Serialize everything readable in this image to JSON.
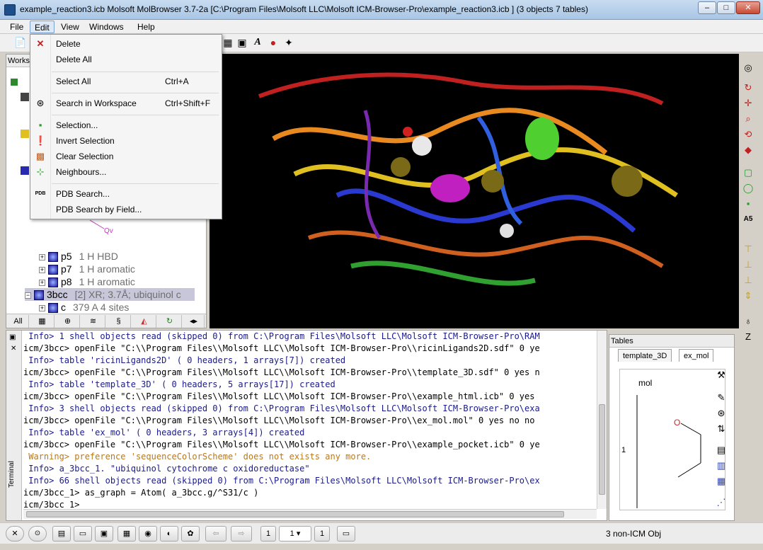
{
  "window": {
    "title": "example_reaction3.icb  Molsoft MolBrowser 3.7-2a  [C:\\Program Files\\Molsoft LLC\\Molsoft ICM-Browser-Pro\\example_reaction3.icb ] (3 objects 7 tables)",
    "minimize": "–",
    "maximize": "□",
    "close": "✕"
  },
  "menubar": [
    "File",
    "Edit",
    "View",
    "Windows",
    "Help"
  ],
  "edit_menu": [
    {
      "label": "Delete",
      "shortcut": "",
      "icon": "delete-icon"
    },
    {
      "label": "Delete All",
      "shortcut": "",
      "icon": ""
    },
    {
      "label": "Select All",
      "shortcut": "Ctrl+A",
      "icon": ""
    },
    {
      "label": "Search in Workspace",
      "shortcut": "Ctrl+Shift+F",
      "icon": "binoculars-icon"
    },
    {
      "label": "Selection...",
      "shortcut": "",
      "icon": "selection-icon"
    },
    {
      "label": "Invert Selection",
      "shortcut": "",
      "icon": "invert-selection-icon"
    },
    {
      "label": "Clear Selection",
      "shortcut": "",
      "icon": "clear-selection-icon"
    },
    {
      "label": "Neighbours...",
      "shortcut": "",
      "icon": "neighbours-icon"
    },
    {
      "label": "PDB Search...",
      "shortcut": "",
      "icon": "pdb-icon"
    },
    {
      "label": "PDB Search by Field...",
      "shortcut": "",
      "icon": ""
    }
  ],
  "workspace": {
    "tab": "Works",
    "tree": [
      {
        "name": "p5",
        "desc": "1 H HBD"
      },
      {
        "name": "p7",
        "desc": "1 H aromatic"
      },
      {
        "name": "p8",
        "desc": "1 H aromatic"
      },
      {
        "name": "3bcc",
        "desc": "[2] XR; 3.7Å; ubiquinol c"
      },
      {
        "name": "c",
        "desc": "379 A  4 sites"
      }
    ],
    "molecule_label": "Qv",
    "bottom_tabs": [
      "All"
    ]
  },
  "terminal": {
    "label": "Terminal",
    "lines": [
      {
        "kind": "info",
        "text": " Info> 1 shell objects read (skipped 0) from C:\\Program Files\\Molsoft LLC\\Molsoft ICM-Browser-Pro\\RAM"
      },
      {
        "kind": "cmd",
        "text": "icm/3bcc> openFile \"C:\\\\Program Files\\\\Molsoft LLC\\\\Molsoft ICM-Browser-Pro\\\\ricinLigands2D.sdf\" 0 ye"
      },
      {
        "kind": "info",
        "text": " Info> table 'ricinLigands2D' ( 0 headers, 1 arrays[7]) created"
      },
      {
        "kind": "cmd",
        "text": "icm/3bcc> openFile \"C:\\\\Program Files\\\\Molsoft LLC\\\\Molsoft ICM-Browser-Pro\\\\template_3D.sdf\" 0 yes n"
      },
      {
        "kind": "info",
        "text": " Info> table 'template_3D' ( 0 headers, 5 arrays[17]) created"
      },
      {
        "kind": "cmd",
        "text": "icm/3bcc> openFile \"C:\\\\Program Files\\\\Molsoft LLC\\\\Molsoft ICM-Browser-Pro\\\\example_html.icb\" 0 yes"
      },
      {
        "kind": "info",
        "text": " Info> 3 shell objects read (skipped 0) from C:\\Program Files\\Molsoft LLC\\Molsoft ICM-Browser-Pro\\exa"
      },
      {
        "kind": "cmd",
        "text": "icm/3bcc> openFile \"C:\\\\Program Files\\\\Molsoft LLC\\\\Molsoft ICM-Browser-Pro\\\\ex_mol.mol\" 0 yes no no"
      },
      {
        "kind": "info",
        "text": " Info> table 'ex_mol' ( 0 headers, 3 arrays[4]) created"
      },
      {
        "kind": "cmd",
        "text": "icm/3bcc> openFile \"C:\\\\Program Files\\\\Molsoft LLC\\\\Molsoft ICM-Browser-Pro\\\\example_pocket.icb\" 0 ye"
      },
      {
        "kind": "warn",
        "text": " Warning> preference 'sequenceColorScheme' does not exists any more."
      },
      {
        "kind": "info",
        "text": " Info> a_3bcc_1. \"ubiquinol cytochrome c oxidoreductase\""
      },
      {
        "kind": "info",
        "text": " Info> 66 shell objects read (skipped 0) from C:\\Program Files\\Molsoft LLC\\Molsoft ICM-Browser-Pro\\ex"
      },
      {
        "kind": "cmd",
        "text": "icm/3bcc_1> as_graph = Atom( a_3bcc.g/^S31/c )"
      },
      {
        "kind": "cmd",
        "text": "icm/3bcc_1> "
      }
    ]
  },
  "tables": {
    "title": "Tables",
    "tabs": [
      "template_3D",
      "ex_mol"
    ],
    "column": "mol",
    "row_index": "1",
    "atom_label": "O"
  },
  "statusbar": {
    "page_field": "1",
    "page_select": "1",
    "page_total": "1",
    "status": "3 non-ICM Obj"
  },
  "colors": {
    "viewer_bg": "#000000",
    "menu_highlight": "#dce8f6",
    "info_text": "#1a1a8c",
    "warn_text": "#b7791f",
    "string_text": "#008080"
  }
}
